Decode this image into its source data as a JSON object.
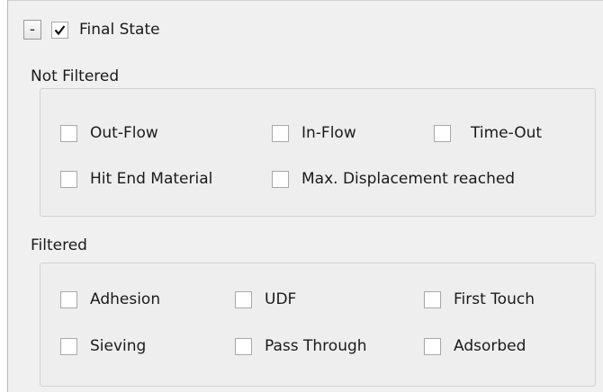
{
  "header": {
    "collapse_label": "-",
    "enabled": true,
    "label": "Final State"
  },
  "not_filtered": {
    "label": "Not Filtered",
    "options": [
      {
        "label": "Out-Flow",
        "checked": false
      },
      {
        "label": "In-Flow",
        "checked": false
      },
      {
        "label": "Time-Out",
        "checked": false
      },
      {
        "label": "Hit End Material",
        "checked": false
      },
      {
        "label": "Max. Displacement reached",
        "checked": false
      }
    ]
  },
  "filtered": {
    "label": "Filtered",
    "options": [
      {
        "label": "Adhesion",
        "checked": false
      },
      {
        "label": "UDF",
        "checked": false
      },
      {
        "label": "First Touch",
        "checked": false
      },
      {
        "label": "Sieving",
        "checked": false
      },
      {
        "label": "Pass Through",
        "checked": false
      },
      {
        "label": "Adsorbed",
        "checked": false
      }
    ]
  }
}
